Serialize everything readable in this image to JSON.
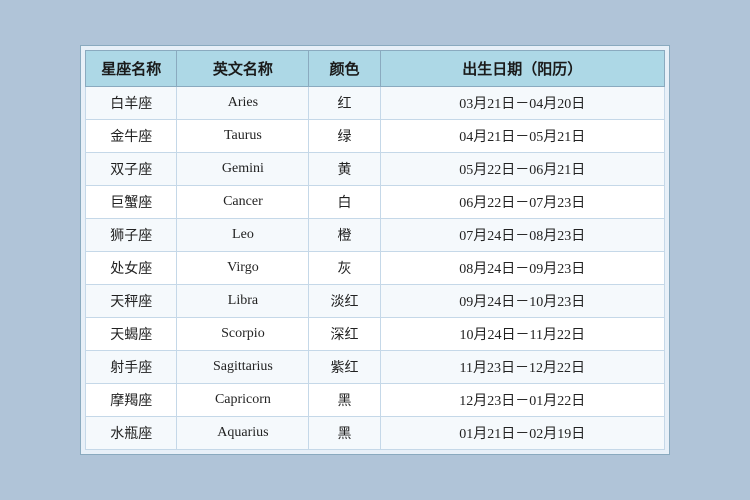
{
  "table": {
    "headers": [
      "星座名称",
      "英文名称",
      "颜色",
      "出生日期（阳历）"
    ],
    "rows": [
      {
        "zh": "白羊座",
        "en": "Aries",
        "color": "红",
        "date": "03月21日－04月20日"
      },
      {
        "zh": "金牛座",
        "en": "Taurus",
        "color": "绿",
        "date": "04月21日－05月21日"
      },
      {
        "zh": "双子座",
        "en": "Gemini",
        "color": "黄",
        "date": "05月22日－06月21日"
      },
      {
        "zh": "巨蟹座",
        "en": "Cancer",
        "color": "白",
        "date": "06月22日－07月23日"
      },
      {
        "zh": "狮子座",
        "en": "Leo",
        "color": "橙",
        "date": "07月24日－08月23日"
      },
      {
        "zh": "处女座",
        "en": "Virgo",
        "color": "灰",
        "date": "08月24日－09月23日"
      },
      {
        "zh": "天秤座",
        "en": "Libra",
        "color": "淡红",
        "date": "09月24日－10月23日"
      },
      {
        "zh": "天蝎座",
        "en": "Scorpio",
        "color": "深红",
        "date": "10月24日－11月22日"
      },
      {
        "zh": "射手座",
        "en": "Sagittarius",
        "color": "紫红",
        "date": "11月23日－12月22日"
      },
      {
        "zh": "摩羯座",
        "en": "Capricorn",
        "color": "黑",
        "date": "12月23日－01月22日"
      },
      {
        "zh": "水瓶座",
        "en": "Aquarius",
        "color": "黑",
        "date": "01月21日－02月19日"
      }
    ]
  }
}
